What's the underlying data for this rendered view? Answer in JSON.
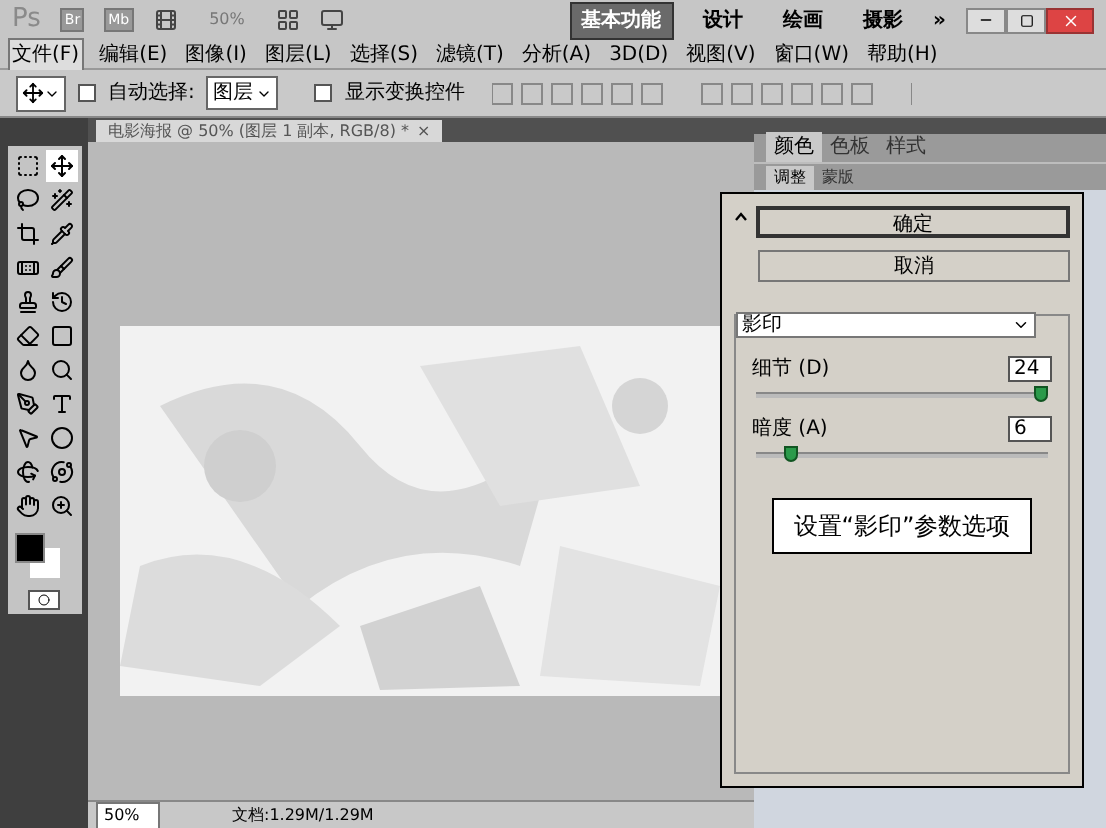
{
  "app_bar": {
    "logo": "Ps",
    "bridge": "Br",
    "mini_bridge": "Mb",
    "zoom": "50%",
    "workspaces": [
      {
        "label": "基本功能",
        "selected": true
      },
      {
        "label": "设计",
        "selected": false
      },
      {
        "label": "绘画",
        "selected": false
      },
      {
        "label": "摄影",
        "selected": false
      }
    ],
    "more": "»"
  },
  "menu": [
    {
      "label": "文件(F)",
      "selected": true
    },
    {
      "label": "编辑(E)",
      "selected": false
    },
    {
      "label": "图像(I)",
      "selected": false
    },
    {
      "label": "图层(L)",
      "selected": false
    },
    {
      "label": "选择(S)",
      "selected": false
    },
    {
      "label": "滤镜(T)",
      "selected": false
    },
    {
      "label": "分析(A)",
      "selected": false
    },
    {
      "label": "3D(D)",
      "selected": false
    },
    {
      "label": "视图(V)",
      "selected": false
    },
    {
      "label": "窗口(W)",
      "selected": false
    },
    {
      "label": "帮助(H)",
      "selected": false
    }
  ],
  "options": {
    "auto_select": {
      "label": "自动选择:",
      "checked": false
    },
    "target": "图层",
    "show_transform": {
      "label": "显示变换控件",
      "checked": false
    }
  },
  "document_tab": {
    "title": "电影海报 @ 50% (图层 1 副本, RGB/8) *",
    "close": "×"
  },
  "tools": [
    {
      "selected": false
    },
    {
      "selected": true
    },
    {
      "selected": false
    },
    {
      "selected": false
    },
    {
      "selected": false
    },
    {
      "selected": false
    },
    {
      "selected": false
    },
    {
      "selected": false
    },
    {
      "selected": false
    },
    {
      "selected": false
    },
    {
      "selected": false
    },
    {
      "selected": false
    },
    {
      "selected": false
    },
    {
      "selected": false
    },
    {
      "selected": false
    },
    {
      "selected": false
    },
    {
      "selected": false
    },
    {
      "selected": false
    },
    {
      "selected": false
    },
    {
      "selected": false
    },
    {
      "selected": false
    },
    {
      "selected": false
    }
  ],
  "status_bar": {
    "zoom": "50%",
    "doc_size": "文档:1.29M/1.29M"
  },
  "panels": {
    "top_tabs": [
      {
        "label": "颜色",
        "selected": true
      },
      {
        "label": "色板",
        "selected": false
      },
      {
        "label": "样式",
        "selected": false
      }
    ],
    "second_tabs": [
      {
        "label": "调整",
        "selected": true
      },
      {
        "label": "蒙版",
        "selected": false
      }
    ]
  },
  "dialog": {
    "ok": "确定",
    "cancel": "取消",
    "filter": "影印",
    "params": [
      {
        "label": "细节 (D)",
        "value": "24",
        "level": 0.98
      },
      {
        "label": "暗度 (A)",
        "value": "6",
        "level": 0.12
      }
    ]
  },
  "callout": "设置“影印”参数选项"
}
